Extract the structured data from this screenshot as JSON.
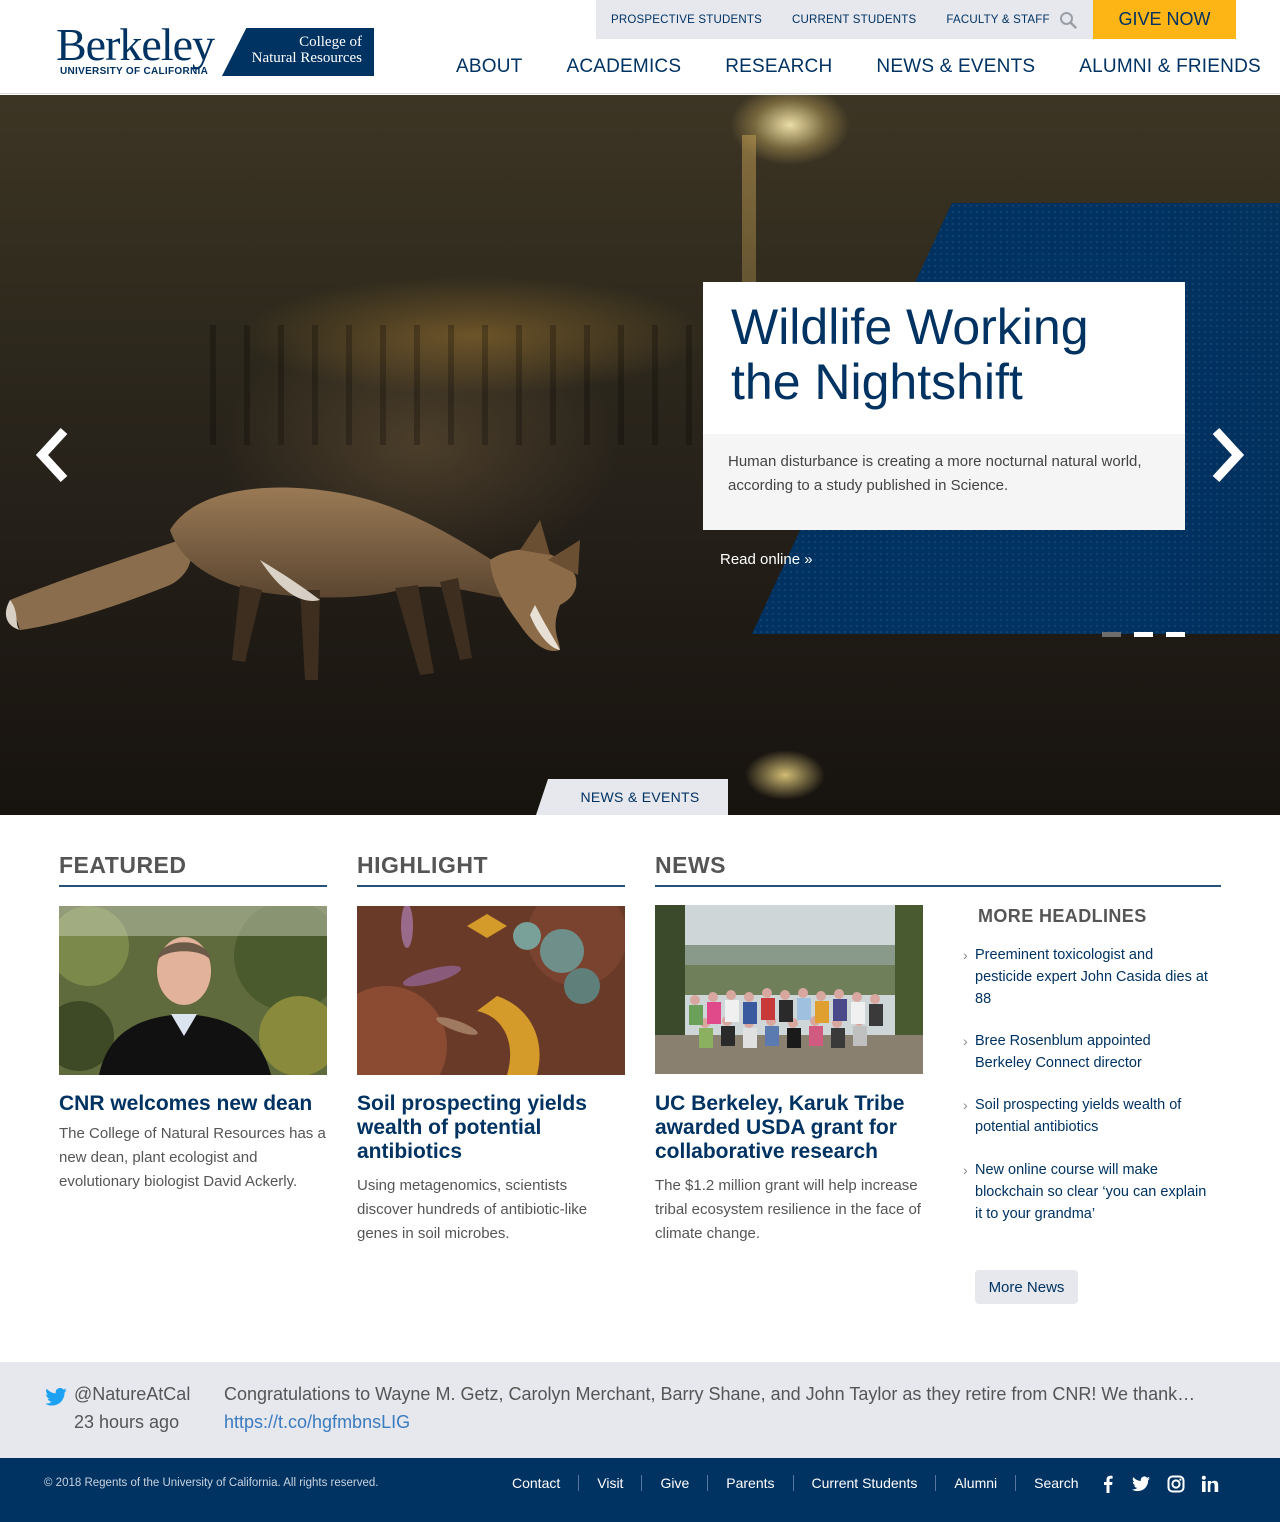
{
  "header": {
    "logo": {
      "wordmark": "Berkeley",
      "subtitle": "UNIVERSITY OF CALIFORNIA",
      "college_line1": "College of",
      "college_line2": "Natural Resources"
    },
    "utility_links": [
      "PROSPECTIVE STUDENTS",
      "CURRENT STUDENTS",
      "FACULTY & STAFF"
    ],
    "give_label": "GIVE NOW",
    "main_nav": [
      "ABOUT",
      "ACADEMICS",
      "RESEARCH",
      "NEWS & EVENTS",
      "ALUMNI & FRIENDS"
    ]
  },
  "hero": {
    "title": "Wildlife Working the Nightshift",
    "description": "Human disturbance is creating a more nocturnal natural world, according to a study published in Science.",
    "cta": "Read online »",
    "slide_count": 3,
    "active_slide": 3,
    "tab_label": "NEWS & EVENTS"
  },
  "sections": {
    "featured": {
      "heading": "FEATURED",
      "title": "CNR welcomes new dean",
      "text": "The College of Natural Resources has a new dean, plant ecologist and evolutionary biologist David Ackerly."
    },
    "highlight": {
      "heading": "HIGHLIGHT",
      "title": "Soil prospecting yields wealth of potential antibiotics",
      "text": "Using metagenomics, scientists discover hundreds of antibiotic-like genes in soil microbes."
    },
    "news": {
      "heading": "NEWS",
      "title": "UC Berkeley, Karuk Tribe awarded USDA grant for collaborative research",
      "text": "The $1.2 million grant will help increase tribal ecosystem resilience in the face of climate change."
    },
    "more_headlines": {
      "heading": "MORE HEADLINES",
      "items": [
        "Preeminent toxicologist and pesticide expert John Casida dies at 88",
        "Bree Rosenblum appointed Berkeley Connect director",
        "Soil prospecting yields wealth of potential antibiotics",
        "New online course will make blockchain so clear ‘you can explain it to your grandma’"
      ],
      "button": "More News"
    }
  },
  "twitter": {
    "handle": "@NatureAtCal",
    "time": "23 hours ago",
    "text": "Congratulations to Wayne M. Getz, Carolyn Merchant, Barry Shane, and John Taylor as they retire from CNR! We thank…",
    "link": "https://t.co/hgfmbnsLIG"
  },
  "footer": {
    "copyright": "© 2018 Regents of the University of California. All rights reserved.",
    "links": [
      "Contact",
      "Visit",
      "Give",
      "Parents",
      "Current Students",
      "Alumni",
      "Search"
    ],
    "social_icons": [
      "facebook-icon",
      "twitter-icon",
      "instagram-icon",
      "linkedin-icon"
    ]
  },
  "colors": {
    "berkeley_blue": "#003262",
    "california_gold": "#fdb515",
    "light_gray": "#e6e8ee",
    "twitter_blue": "#1da1f2"
  }
}
